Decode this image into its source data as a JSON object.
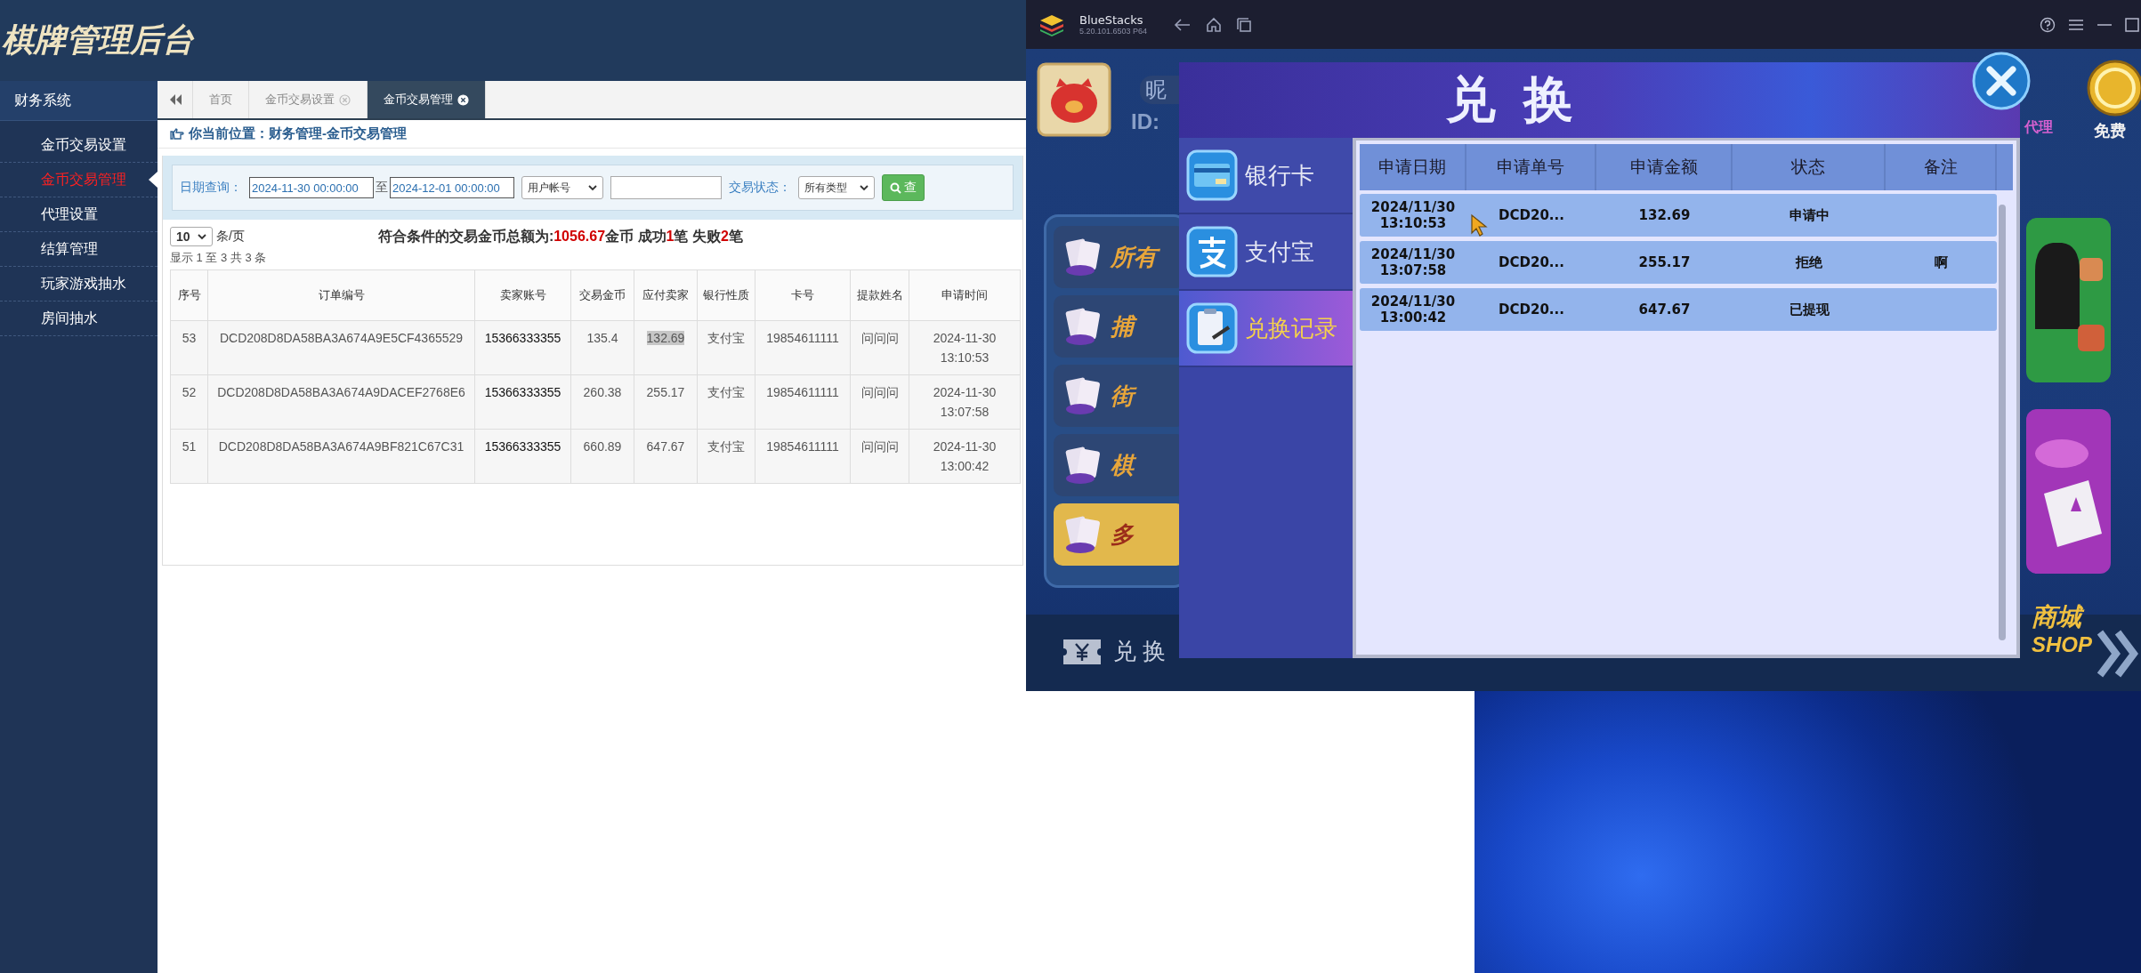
{
  "admin": {
    "title": "棋牌管理后台",
    "sidebar": {
      "header": "财务系统",
      "items": [
        {
          "label": "金币交易设置",
          "selected": false
        },
        {
          "label": "金币交易管理",
          "selected": true
        },
        {
          "label": "代理设置",
          "selected": false
        },
        {
          "label": "结算管理",
          "selected": false
        },
        {
          "label": "玩家游戏抽水",
          "selected": false
        },
        {
          "label": "房间抽水",
          "selected": false
        }
      ]
    },
    "tabs": [
      {
        "label": "首页",
        "selected": false,
        "closable": false
      },
      {
        "label": "金币交易设置",
        "selected": false,
        "closable": true
      },
      {
        "label": "金币交易管理",
        "selected": true,
        "closable": true
      }
    ],
    "breadcrumb": "你当前位置：财务管理-金币交易管理",
    "filter": {
      "date_label": "日期查询：",
      "date_from": "2024-11-30 00:00:00",
      "separator": "至",
      "date_to": "2024-12-01 00:00:00",
      "account_type": "用户帐号",
      "status_label": "交易状态：",
      "status": "所有类型",
      "search_button": "查"
    },
    "page_size": "10",
    "page_size_unit": "条/页",
    "summary": [
      {
        "text": "符合条件的交易金币总额为:",
        "emphasis": false
      },
      {
        "text": "1056.67",
        "emphasis": true
      },
      {
        "text": "金币 成功",
        "emphasis": false
      },
      {
        "text": "1",
        "emphasis": true
      },
      {
        "text": "笔 失败",
        "emphasis": false
      },
      {
        "text": "2",
        "emphasis": true
      },
      {
        "text": "笔",
        "emphasis": false
      }
    ],
    "showing": "显示 1 至 3 共 3 条",
    "table": {
      "columns": [
        "序号",
        "订单编号",
        "卖家账号",
        "交易金币",
        "应付卖家",
        "银行性质",
        "卡号",
        "提款姓名",
        "申请时间"
      ],
      "rows": [
        {
          "cells": [
            "53",
            "DCD208D8DA58BA3A674A9E5CF4365529",
            "15366333355",
            "135.4",
            "132.69",
            "支付宝",
            "19854611111",
            "问问问",
            "2024-11-30 13:10:53"
          ],
          "highlight_payable": true
        },
        {
          "cells": [
            "52",
            "DCD208D8DA58BA3A674A9DACEF2768E6",
            "15366333355",
            "260.38",
            "255.17",
            "支付宝",
            "19854611111",
            "问问问",
            "2024-11-30 13:07:58"
          ],
          "highlight_payable": false
        },
        {
          "cells": [
            "51",
            "DCD208D8DA58BA3A674A9BF821C67C31",
            "15366333355",
            "660.89",
            "647.67",
            "支付宝",
            "19854611111",
            "问问问",
            "2024-11-30 13:00:42"
          ],
          "highlight_payable": false
        }
      ]
    }
  },
  "emulator": {
    "title": "BlueStacks",
    "version": "5.20.101.6503 P64",
    "game": {
      "nickname_label": "昵",
      "id_label": "ID:",
      "menu": [
        "所有",
        "捕",
        "街",
        "棋",
        "多"
      ],
      "bottom_label": "兑 换",
      "agent_label": "代理",
      "free_label": "免费",
      "shop_label": "商城",
      "shop_sub": "SHOP"
    },
    "dialog": {
      "title": "兑 换",
      "tabs": [
        {
          "label": "银行卡",
          "kind": "card",
          "selected": false
        },
        {
          "label": "支付宝",
          "kind": "payment",
          "selected": false
        },
        {
          "label": "兑换记录",
          "kind": "record",
          "selected": true
        }
      ],
      "columns": [
        "申请日期",
        "申请单号",
        "申请金额",
        "状态",
        "备注"
      ],
      "rows": [
        {
          "date": "2024/11/30",
          "time": "13:10:53",
          "order": "DCD20...",
          "amount": "132.69",
          "status": "申请中"
        },
        {
          "date": "2024/11/30",
          "time": "13:07:58",
          "order": "DCD20...",
          "amount": "255.17",
          "status": "拒绝",
          "note": "啊"
        },
        {
          "date": "2024/11/30",
          "time": "13:00:42",
          "order": "DCD20...",
          "amount": "647.67",
          "status": "已提现"
        }
      ]
    }
  }
}
